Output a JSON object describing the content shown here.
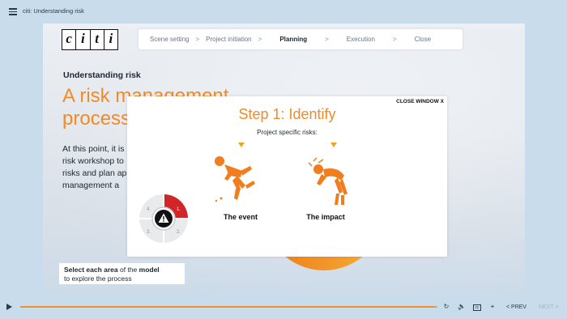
{
  "window": {
    "title": "citi: Understanding risk"
  },
  "logo": {
    "letters": [
      "c",
      "i",
      "t",
      "i"
    ]
  },
  "steps": [
    {
      "label": "Scene setting",
      "active": false
    },
    {
      "label": "Project initiation",
      "active": false
    },
    {
      "label": "Planning",
      "active": true
    },
    {
      "label": "Execution",
      "active": false
    },
    {
      "label": "Close",
      "active": false
    }
  ],
  "separator": ">",
  "slide": {
    "kicker": "Understanding risk",
    "headline_line1": "A risk management",
    "headline_line2": "process",
    "body_lines": [
      "At this point, it is",
      "risk workshop to",
      "risks and plan ap",
      "management a"
    ]
  },
  "hint": {
    "bold1": "Select each area",
    "text1": " of the ",
    "bold2": "model",
    "text2": "to explore the process"
  },
  "popup": {
    "close_label": "CLOSE WINDOW X",
    "title": "Step 1: Identify",
    "subtitle": "Project specific risks:",
    "items": [
      {
        "label": "The event",
        "icon": "falling-person-icon"
      },
      {
        "label": "The impact",
        "icon": "injured-person-icon"
      }
    ]
  },
  "cycle": {
    "segments": [
      "1.",
      "2.",
      "3.",
      "4."
    ],
    "active": "1.",
    "center_icon": "warning-icon"
  },
  "colors": {
    "accent": "#f28a25",
    "active_segment": "#d0262a",
    "figure": "#f07d1e"
  },
  "player": {
    "progress": 0.995,
    "prev_label": "< PREV",
    "next_label": "NEXT >"
  }
}
